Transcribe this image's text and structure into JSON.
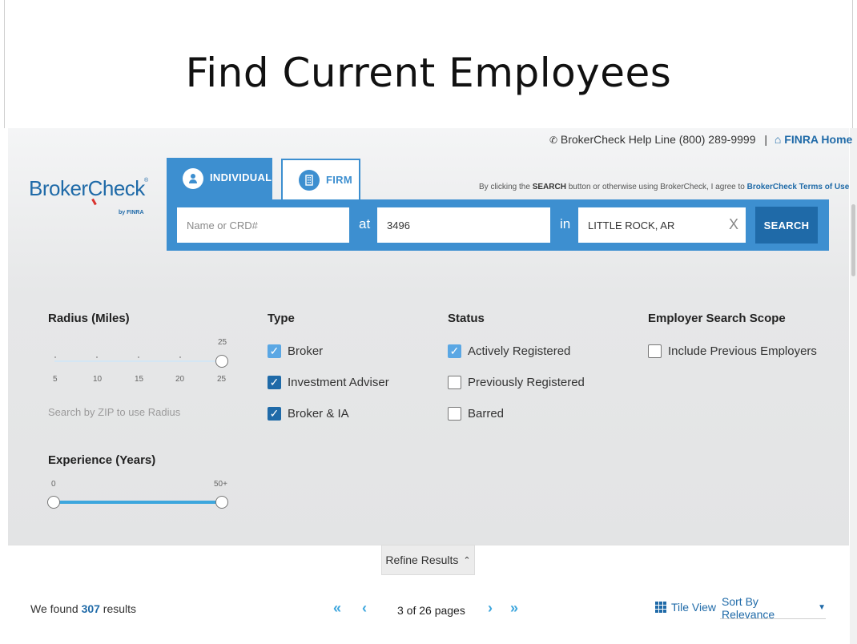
{
  "slide": {
    "title": "Find Current Employees"
  },
  "header": {
    "helpline": "BrokerCheck Help Line (800) 289-9999",
    "separator": "|",
    "home_link": "FINRA Home"
  },
  "logo": {
    "text_a": "Broker",
    "text_c": "C",
    "text_b": "heck",
    "sub": "by FINRA",
    "reg": "®"
  },
  "tabs": [
    {
      "label": "INDIVIDUAL",
      "icon": "person-icon",
      "active": true
    },
    {
      "label": "FIRM",
      "icon": "building-icon",
      "active": false
    }
  ],
  "terms": {
    "prefix": "By clicking the ",
    "bold": "SEARCH",
    "middle": " button or otherwise using BrokerCheck, I agree to ",
    "link": "BrokerCheck Terms of Use"
  },
  "search": {
    "name_placeholder": "Name or CRD#",
    "at_label": "at",
    "at_value": "3496",
    "in_label": "in",
    "location_value": "LITTLE ROCK, AR",
    "clear": "X",
    "button": "SEARCH"
  },
  "filters": {
    "radius": {
      "heading": "Radius (Miles)",
      "value_label": "25",
      "ticks": [
        "5",
        "10",
        "15",
        "20",
        "25"
      ],
      "value": 25,
      "hint": "Search by ZIP to use Radius"
    },
    "experience": {
      "heading": "Experience (Years)",
      "min_label": "0",
      "max_label": "50+",
      "range": [
        0,
        50
      ]
    },
    "type": {
      "heading": "Type",
      "options": [
        {
          "label": "Broker",
          "checked": true
        },
        {
          "label": "Investment Adviser",
          "checked": true
        },
        {
          "label": "Broker & IA",
          "checked": true
        }
      ]
    },
    "status": {
      "heading": "Status",
      "options": [
        {
          "label": "Actively Registered",
          "checked": true
        },
        {
          "label": "Previously Registered",
          "checked": false
        },
        {
          "label": "Barred",
          "checked": false
        }
      ]
    },
    "scope": {
      "heading": "Employer Search Scope",
      "options": [
        {
          "label": "Include Previous Employers",
          "checked": false
        }
      ]
    }
  },
  "refine": {
    "label": "Refine Results",
    "chevron": "«"
  },
  "results": {
    "prefix": "We found ",
    "count": "307",
    "suffix": " results",
    "pagination": {
      "first": "«",
      "prev": "‹",
      "label": "3 of 26 pages",
      "next": "›",
      "last": "»"
    },
    "view_label": "Tile View",
    "sort_label": "Sort By Relevance",
    "sort_caret": "▼"
  },
  "colors": {
    "brand": "#1f6aa8",
    "accent": "#3d8fd0",
    "slider": "#3da6dd"
  }
}
